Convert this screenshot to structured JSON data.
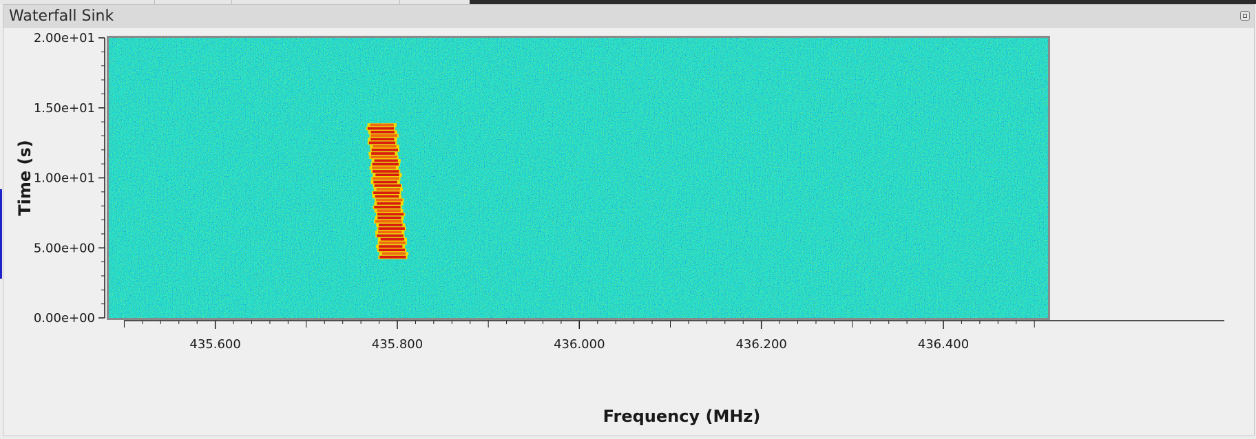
{
  "window": {
    "title": "Waterfall Sink",
    "float_button_icon": "restore-window-icon"
  },
  "colors": {
    "noise_base": "#16e6d6",
    "signal_core": "#d81a10",
    "signal_edge": "#f5d800",
    "accent_bar": "#1e22c8"
  },
  "chart_data": {
    "type": "heatmap",
    "title": "",
    "xlabel": "Frequency (MHz)",
    "ylabel": "Time (s)",
    "x_tick_labels": [
      "435.600",
      "435.800",
      "436.000",
      "436.200",
      "436.400"
    ],
    "x_ticks": [
      435.6,
      435.8,
      436.0,
      436.2,
      436.4
    ],
    "y_tick_labels": [
      "0.00e+00",
      "5.00e+00",
      "1.00e+01",
      "1.50e+01",
      "2.00e+01"
    ],
    "y_ticks": [
      0,
      5,
      10,
      15,
      20
    ],
    "xlim": [
      435.483,
      436.515
    ],
    "ylim": [
      0,
      20
    ],
    "colormap": "jet",
    "grid": false,
    "signals": [
      {
        "center_freq_start_mhz": 435.795,
        "center_freq_end_mhz": 435.783,
        "bandwidth_mhz": 0.032,
        "time_start_s": 4.2,
        "time_end_s": 13.9
      }
    ]
  }
}
